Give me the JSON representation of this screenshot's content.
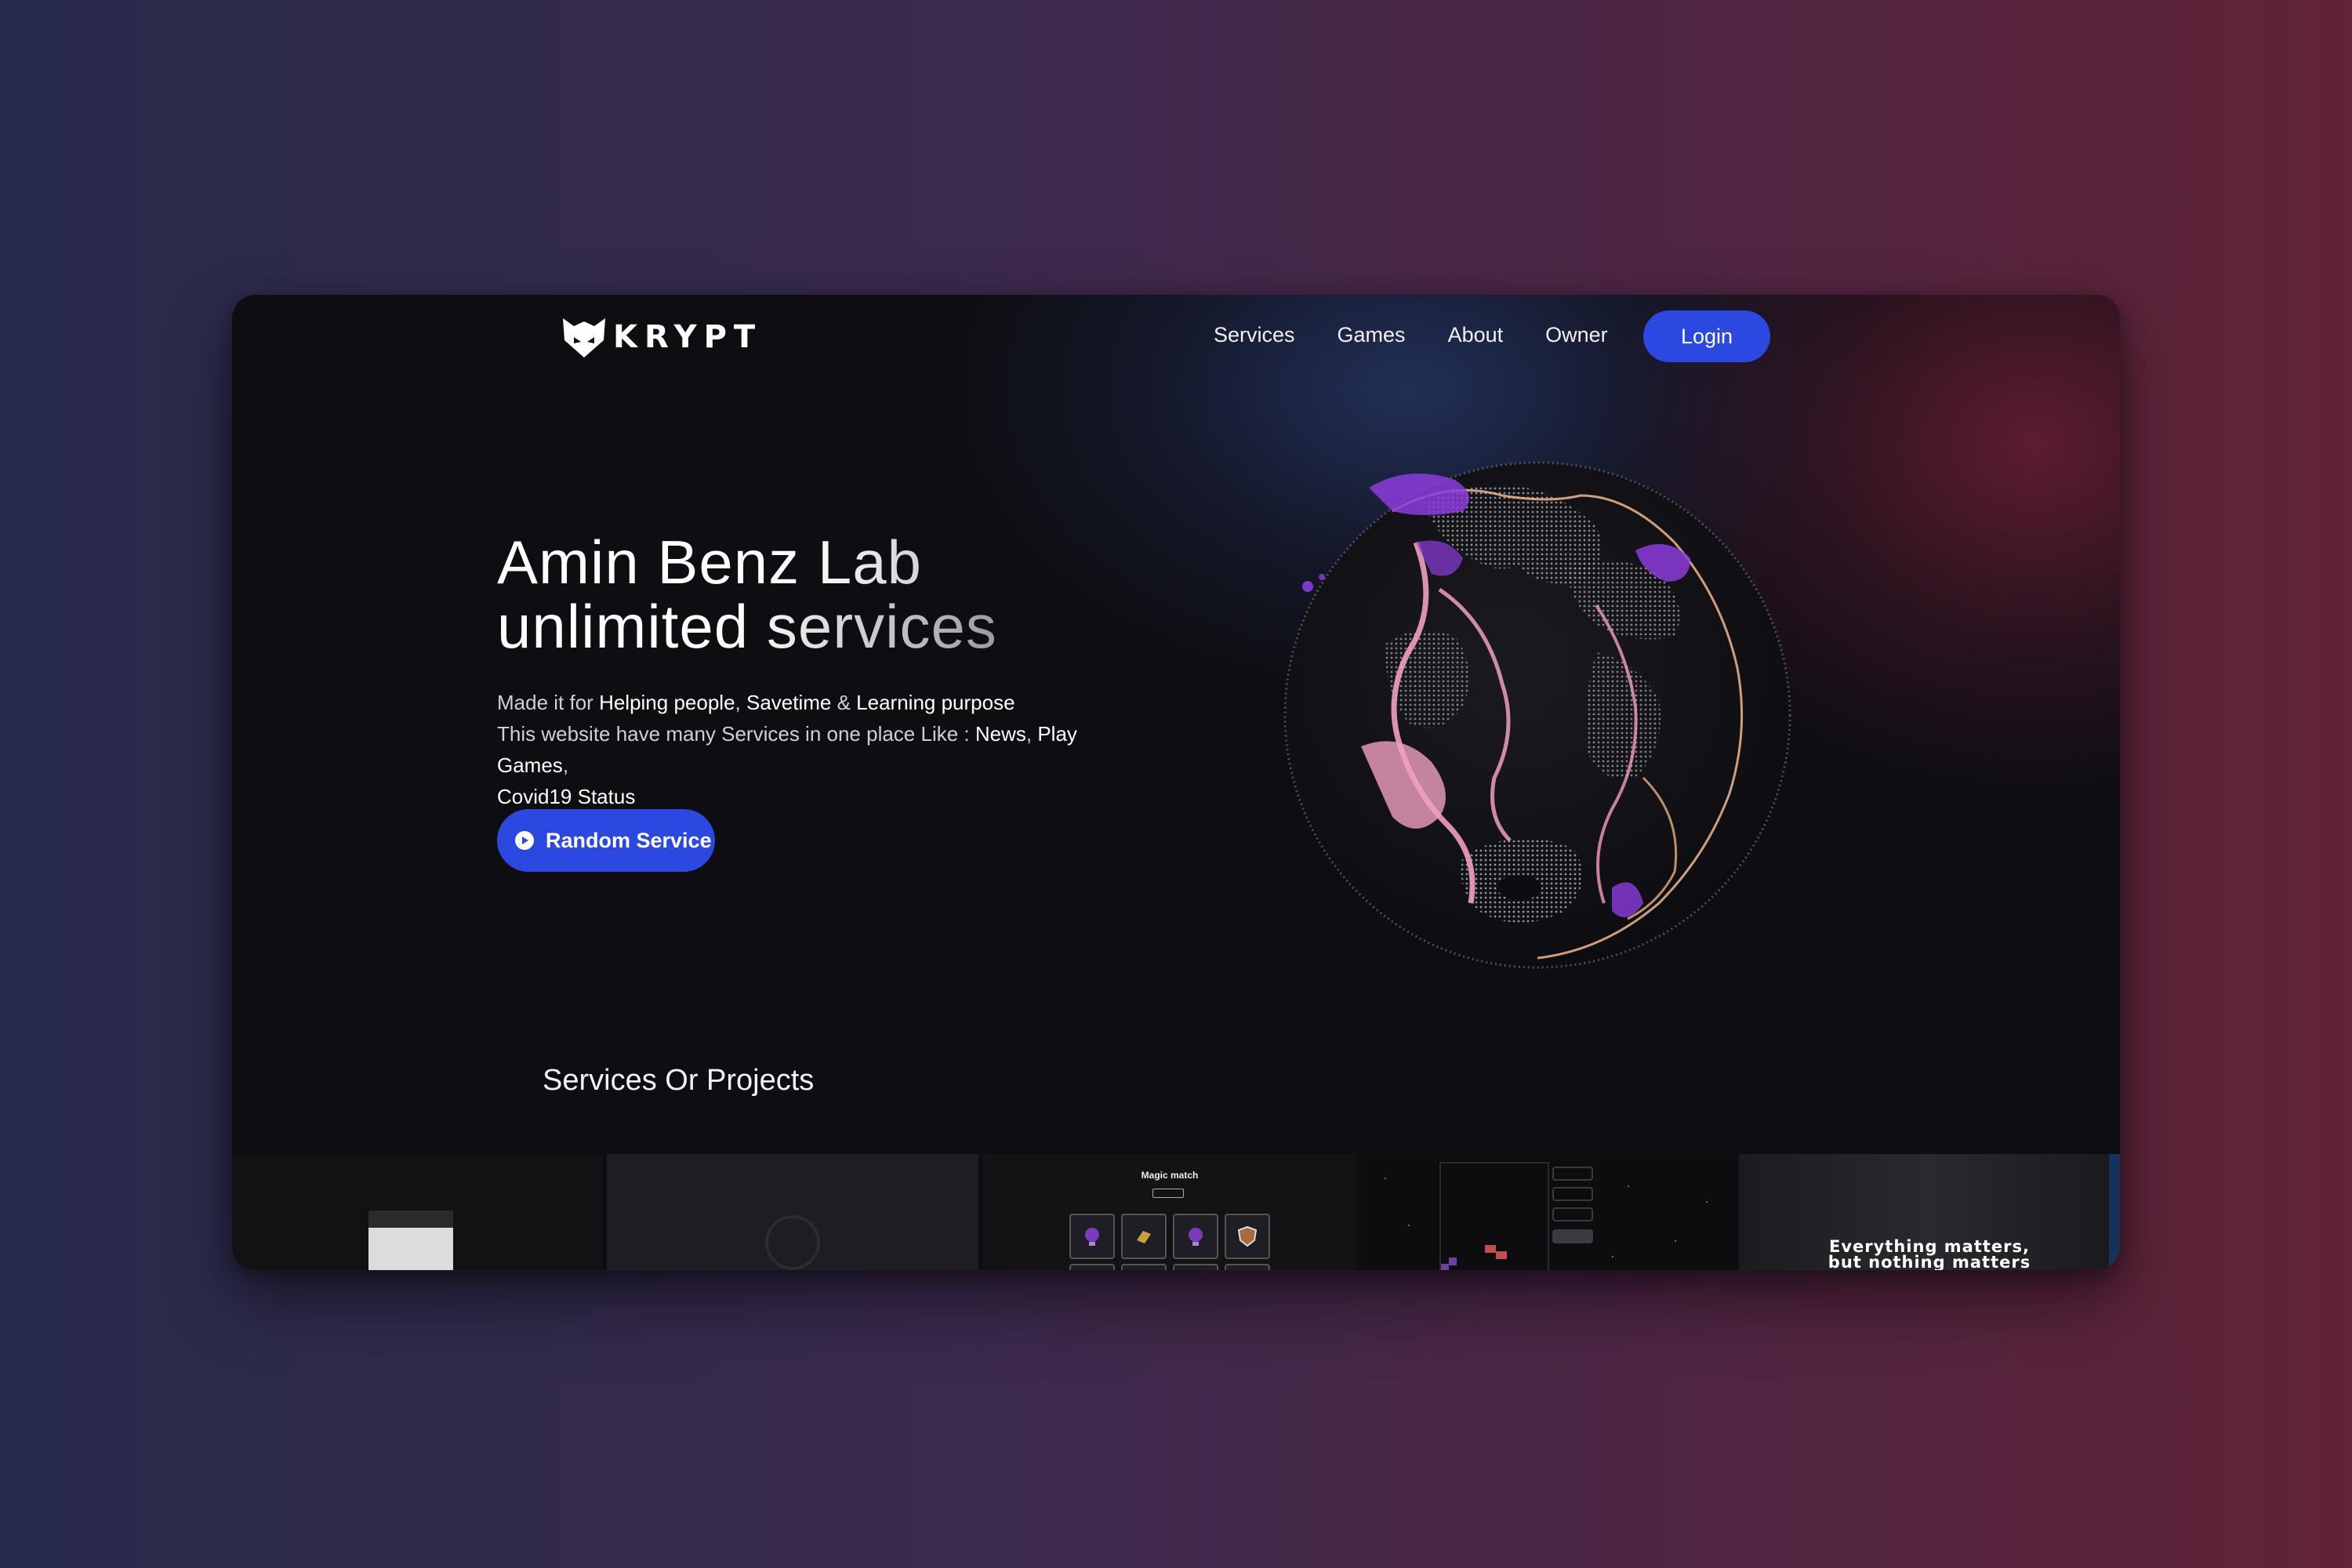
{
  "brand": {
    "name": "KRYPT"
  },
  "nav": {
    "links": [
      "Services",
      "Games",
      "About",
      "Owner"
    ],
    "login_label": "Login"
  },
  "hero": {
    "title_line1": "Amin Benz Lab",
    "title_line2": "unlimited services",
    "desc_line1_prefix": "Made it for ",
    "desc_line1_b1": "Helping people",
    "desc_line1_sep1": ", ",
    "desc_line1_b2": "Savetime",
    "desc_line1_sep2": " & ",
    "desc_line1_b3": "Learning purpose",
    "desc_line2_prefix": "This website have many Services in one place Like : ",
    "desc_line2_b1": "News",
    "desc_line2_sep1": ", ",
    "desc_line2_b2": "Play Games",
    "desc_line2_sep2": ",",
    "desc_line3_b1": "Covid19 Status",
    "random_button_label": "Random Service"
  },
  "section": {
    "title": "Services Or Projects"
  },
  "thumbnails": {
    "magic_match_title": "Magic match",
    "everything_line1": "Everything matters,",
    "everything_line2": "but nothing matters"
  },
  "colors": {
    "accent": "#2b49e0",
    "background": "#0e0e12",
    "globe_pink": "#f0a0c0",
    "globe_purple": "#8c3cdc"
  }
}
